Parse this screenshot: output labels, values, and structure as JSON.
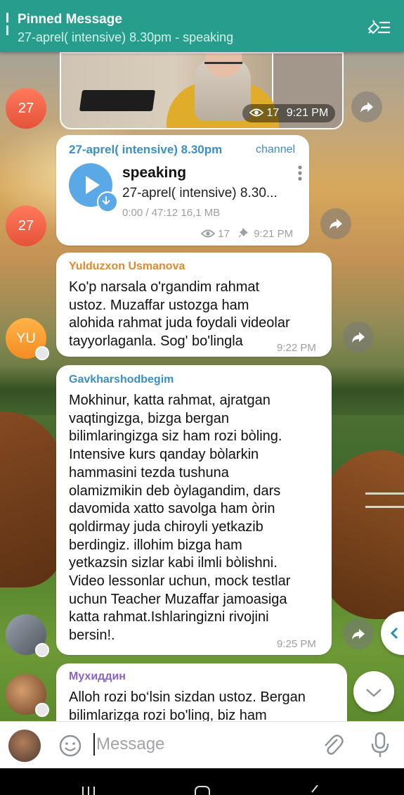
{
  "pinned": {
    "title": "Pinned Message",
    "text": "27-aprel( intensive) 8.30pm - speaking"
  },
  "video_message": {
    "views": "17",
    "time": "9:21 PM"
  },
  "audio_message": {
    "channel_name": "27-aprel( intensive) 8.30pm",
    "channel_label": "channel",
    "track_title": "speaking",
    "track_subtitle": "27-aprel( intensive) 8.30...",
    "progress_size": "0:00 / 47:12  16,1 MB",
    "views": "17",
    "time": "9:21 PM"
  },
  "avatars": {
    "first": "27",
    "second": "27",
    "yu": "YU"
  },
  "messages": [
    {
      "sender": "Yulduzxon Usmanova",
      "sender_color": "#e08a2e",
      "lines": [
        "Ko'p narsala o'rgandim rahmat",
        "ustoz. Muzaffar ustozga ham",
        "alohida rahmat juda foydali videolar",
        "tayyorlaganla. Sog' bo'lingla"
      ],
      "time": "9:22 PM"
    },
    {
      "sender": "Gavkharshodbegim",
      "sender_color": "#3a8fc8",
      "lines": [
        "Mokhinur, katta rahmat, ajratgan",
        "vaqtingizga, bizga bergan",
        "bilimlaringizga siz ham rozi bòling.",
        "Intensive kurs qanday bòlarkin",
        "hammasini tezda tushuna",
        "olamizmikin deb òylagandim, dars",
        "davomida xatto savolga ham òrin",
        "qoldirmay juda chiroyli yetkazib",
        "berdingiz. illohim bizga ham",
        "yetkazsin sizlar kabi ilmli bòlishni.",
        "Video lessonlar uchun, mock testlar",
        "uchun Teacher Muzaffar jamoasiga",
        "katta rahmat.Ishlaringizni rivojini",
        "bersin!."
      ],
      "time": "9:25 PM"
    },
    {
      "sender": "Мухиддин",
      "sender_color": "#8a63c9",
      "lines": [
        "Alloh rozi bo‘lsin sizdan ustoz. Bergan",
        "bilimlarizga rozi bo'ling, biz ham"
      ],
      "time": ""
    }
  ],
  "input": {
    "placeholder": "Message"
  },
  "icons": [
    "pin-list-icon",
    "share-icon",
    "eye-icon",
    "pin-icon",
    "play-icon",
    "download-icon",
    "emoji-icon",
    "attach-icon",
    "mic-icon",
    "chevron-left-icon",
    "chevron-down-icon"
  ]
}
